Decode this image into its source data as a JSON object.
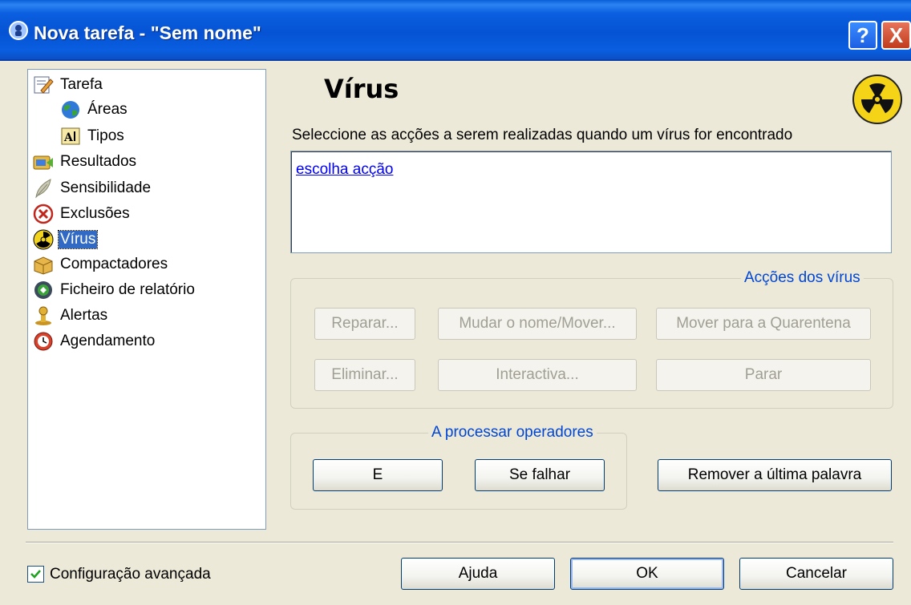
{
  "window": {
    "title": "Nova tarefa - \"Sem nome\"",
    "help_button": "?",
    "close_button": "X"
  },
  "tree": {
    "items": [
      {
        "label": "Tarefa",
        "icon": "task-edit-icon"
      },
      {
        "label": "Áreas",
        "icon": "globe-icon"
      },
      {
        "label": "Tipos",
        "icon": "file-types-icon"
      },
      {
        "label": "Resultados",
        "icon": "results-icon"
      },
      {
        "label": "Sensibilidade",
        "icon": "feather-icon"
      },
      {
        "label": "Exclusões",
        "icon": "exclusion-icon"
      },
      {
        "label": "Vírus",
        "icon": "radiation-icon",
        "selected": true
      },
      {
        "label": "Compactadores",
        "icon": "package-icon"
      },
      {
        "label": "Ficheiro de relatório",
        "icon": "report-file-icon"
      },
      {
        "label": "Alertas",
        "icon": "alert-icon"
      },
      {
        "label": "Agendamento",
        "icon": "clock-icon"
      }
    ]
  },
  "main": {
    "heading": "Vírus",
    "prompt": "Seleccione as acções a serem realizadas quando um vírus for encontrado",
    "action_link": "escolha acção"
  },
  "virus_actions": {
    "title": "Acções dos vírus",
    "buttons": {
      "repair": "Reparar...",
      "rename_move": "Mudar o nome/Mover...",
      "quarantine": "Mover para a Quarentena",
      "delete": "Eliminar...",
      "interactive": "Interactiva...",
      "stop": "Parar"
    }
  },
  "operators": {
    "title": "A processar operadores",
    "and": "E",
    "if_fail": "Se falhar",
    "remove_last": "Remover a última palavra"
  },
  "footer": {
    "advanced_label": "Configuração avançada",
    "advanced_checked": true,
    "help": "Ajuda",
    "ok": "OK",
    "cancel": "Cancelar"
  },
  "colors": {
    "titlebar": "#0553d4",
    "face": "#ece9d8",
    "selection": "#316ac5",
    "group_title": "#0046d5",
    "link": "#0000ff"
  }
}
